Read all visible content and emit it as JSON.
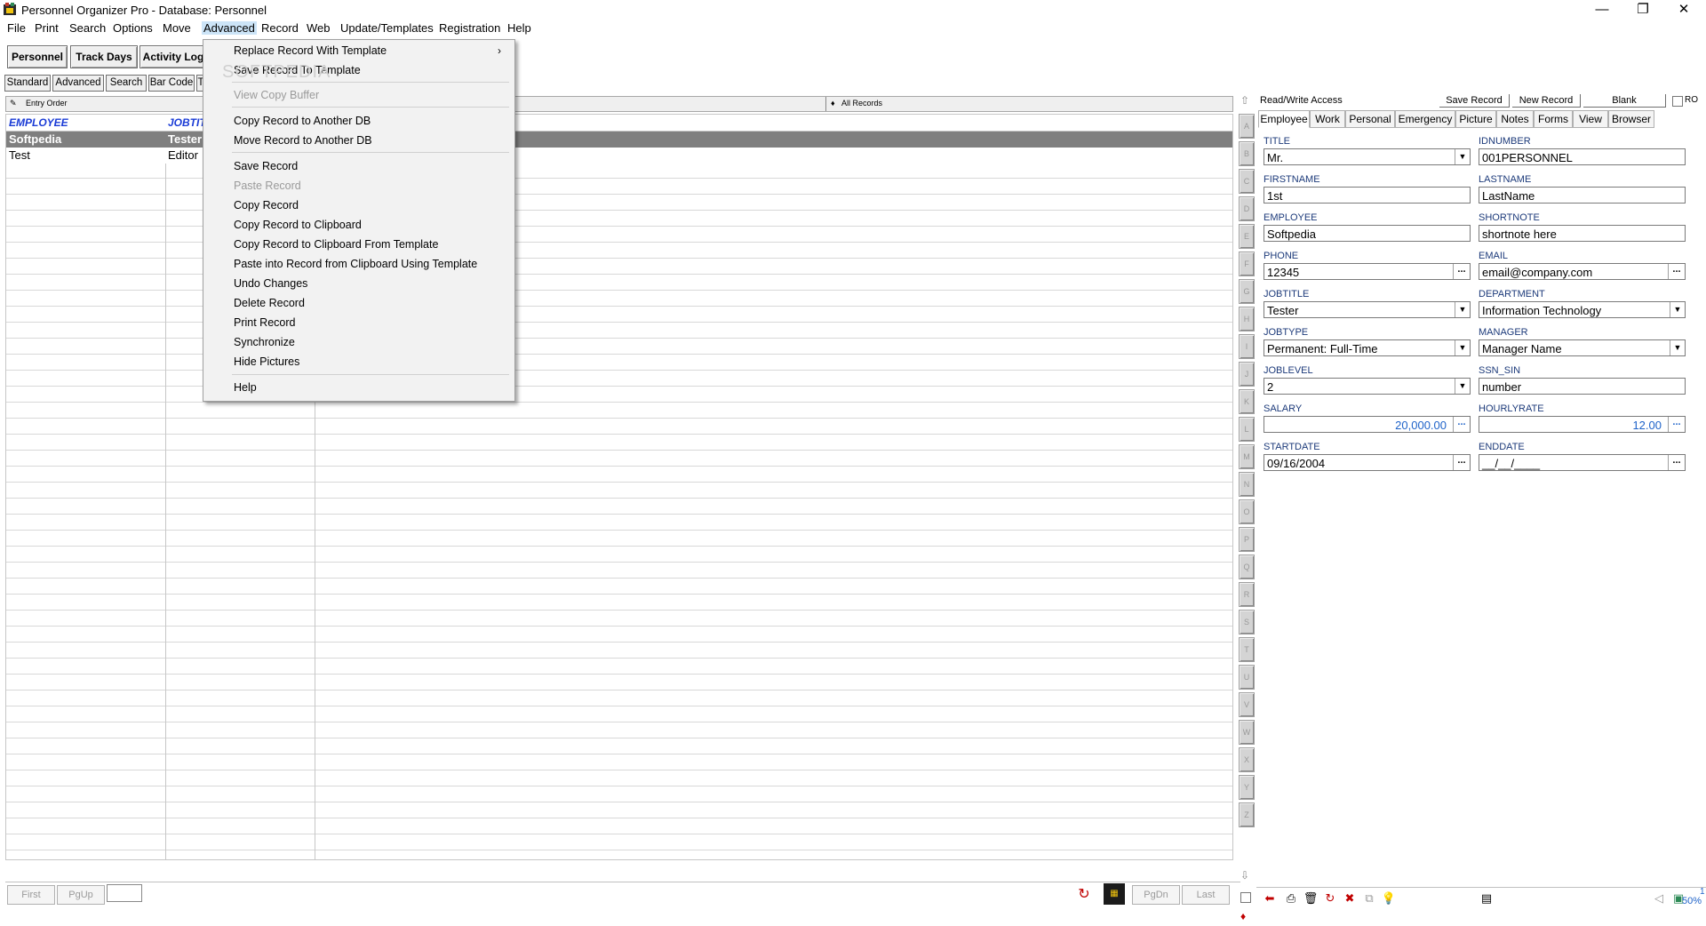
{
  "window": {
    "title": "Personnel Organizer Pro - Database: Personnel",
    "minimize": "—",
    "restore": "❐",
    "close": "✕"
  },
  "menu": [
    "File",
    "Print",
    "Search",
    "Options",
    "Move",
    "Advanced",
    "Record",
    "Web",
    "Update/Templates",
    "Registration",
    "Help"
  ],
  "toolbar": {
    "buttons": [
      "Personnel",
      "Track Days",
      "Activity Log"
    ],
    "subtabs": [
      "Standard",
      "Advanced",
      "Search",
      "Bar Code",
      "T"
    ]
  },
  "grid": {
    "strip_left": "Entry Order",
    "strip_right": "All Records",
    "columns": [
      "EMPLOYEE",
      "JOBTIT"
    ],
    "rows": [
      [
        "Softpedia",
        "Tester"
      ],
      [
        "Test",
        "Editor"
      ]
    ]
  },
  "alphabet": [
    "A",
    "B",
    "C",
    "D",
    "E",
    "F",
    "G",
    "H",
    "I",
    "J",
    "K",
    "L",
    "M",
    "N",
    "O",
    "P",
    "Q",
    "R",
    "S",
    "T",
    "U",
    "V",
    "W",
    "X",
    "Y",
    "Z"
  ],
  "record": {
    "access": "Read/Write Access",
    "save": "Save Record",
    "new": "New Record",
    "blank": "Blank",
    "ro": "RO",
    "tabs": [
      "Employee",
      "Work",
      "Personal",
      "Emergency",
      "Picture",
      "Notes",
      "Forms",
      "View",
      "Browser"
    ],
    "fields": {
      "title_label": "TITLE",
      "title": "Mr.",
      "idnumber_label": "IDNUMBER",
      "idnumber": "001PERSONNEL",
      "firstname_label": "FIRSTNAME",
      "firstname": "1st",
      "lastname_label": "LASTNAME",
      "lastname": "LastName",
      "employee_label": "EMPLOYEE",
      "employee": "Softpedia",
      "shortnote_label": "SHORTNOTE",
      "shortnote": "shortnote here",
      "phone_label": "PHONE",
      "phone": "12345",
      "email_label": "EMAIL",
      "email": "email@company.com",
      "jobtitle_label": "JOBTITLE",
      "jobtitle": "Tester",
      "department_label": "DEPARTMENT",
      "department": "Information Technology",
      "jobtype_label": "JOBTYPE",
      "jobtype": "Permanent: Full-Time",
      "manager_label": "MANAGER",
      "manager": "Manager Name",
      "joblevel_label": "JOBLEVEL",
      "joblevel": "2",
      "ssn_label": "SSN_SIN",
      "ssn": "number",
      "salary_label": "SALARY",
      "salary": "20,000.00",
      "hourly_label": "HOURLYRATE",
      "hourly": "12.00",
      "startdate_label": "STARTDATE",
      "startdate": "09/16/2004",
      "enddate_label": "ENDDATE",
      "enddate": "__/__/____"
    }
  },
  "nav": {
    "first": "First",
    "pgup": "PgUp",
    "pgdn": "PgDn",
    "last": "Last"
  },
  "status": {
    "zoom": "50%",
    "one": "1"
  },
  "dropdown": {
    "items": [
      {
        "label": "Replace Record With Template",
        "disabled": false
      },
      {
        "label": "Save Record To Template",
        "disabled": false
      },
      {
        "label": "View Copy Buffer",
        "disabled": true
      },
      {
        "label": "Copy Record to Another DB",
        "disabled": false
      },
      {
        "label": "Move Record to Another DB",
        "disabled": false
      },
      {
        "label": "Save Record",
        "disabled": false
      },
      {
        "label": "Paste Record",
        "disabled": true
      },
      {
        "label": "Copy Record",
        "disabled": false
      },
      {
        "label": "Copy Record to Clipboard",
        "disabled": false
      },
      {
        "label": "Copy Record to Clipboard From Template",
        "disabled": false
      },
      {
        "label": "Paste into Record from Clipboard Using Template",
        "disabled": false
      },
      {
        "label": "Undo Changes",
        "disabled": false
      },
      {
        "label": "Delete Record",
        "disabled": false
      },
      {
        "label": "Print Record",
        "disabled": false
      },
      {
        "label": "Synchronize",
        "disabled": false
      },
      {
        "label": "Hide Pictures",
        "disabled": false
      },
      {
        "label": "Help",
        "disabled": false
      }
    ],
    "watermark": "SOFTPEDIA"
  },
  "colors": {
    "header_text": "#1a3bd6",
    "selected_row": "#7f7f7f",
    "label_text": "#1c3a7a",
    "numeric_text": "#1f63c9"
  }
}
